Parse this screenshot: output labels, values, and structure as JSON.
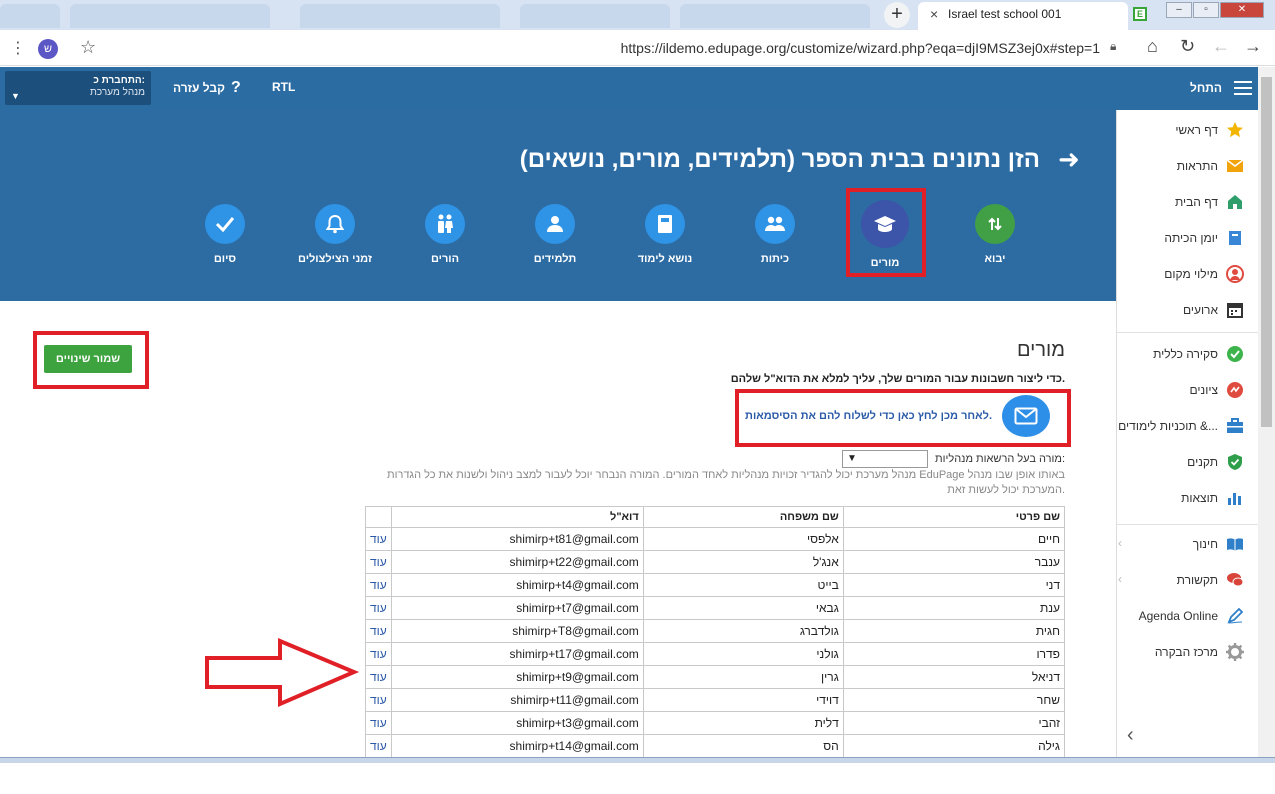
{
  "browser": {
    "tab_title": "Israel test school 001",
    "tab_close": "×",
    "new_tab": "+",
    "favicon_letter": "E",
    "url": "https://ildemo.edupage.org/customize/wizard.php?eqa=djI9MSZ3ej0x#step=1",
    "extension_letter": "ש",
    "window_controls": [
      "–",
      "▫",
      "✕"
    ]
  },
  "header": {
    "account_line1": "התחברת כ:",
    "account_line2": "מנהל מערכת",
    "help_label": "קבל עזרה",
    "help_icon": "?",
    "rtl_label": "RTL",
    "start_label": "התחל"
  },
  "banner": {
    "title": "הזן נתונים בבית הספר (תלמידים, מורים, נושאים)",
    "steps": [
      {
        "label": "יבוא",
        "icon": "import-arrows-icon"
      },
      {
        "label": "מורים",
        "icon": "graduation-cap-icon"
      },
      {
        "label": "כיתות",
        "icon": "group-icon"
      },
      {
        "label": "נושא לימוד",
        "icon": "book-icon"
      },
      {
        "label": "תלמידים",
        "icon": "person-icon"
      },
      {
        "label": "הורים",
        "icon": "parents-icon"
      },
      {
        "label": "זמני הצילצולים",
        "icon": "bell-icon"
      },
      {
        "label": "סיום",
        "icon": "check-icon"
      }
    ],
    "active_step": "מורים"
  },
  "sidebar": {
    "items": [
      {
        "label": "דף ראשי",
        "icon": "star-icon",
        "color": "#f2b600"
      },
      {
        "label": "התראות",
        "icon": "envelope-icon",
        "color": "#f0a30a"
      },
      {
        "label": "דף הבית",
        "icon": "house-icon",
        "color": "#2e9e6a"
      },
      {
        "label": "יומן הכיתה",
        "icon": "notebook-icon",
        "color": "#3a86d6"
      },
      {
        "label": "מילוי מקום",
        "icon": "substitute-icon",
        "color": "#e04b3f"
      },
      {
        "label": "ארועים",
        "icon": "calendar-icon",
        "color": "#333333"
      },
      {
        "label": "סקירה כללית",
        "icon": "check-circle-icon",
        "color": "#3cb44b"
      },
      {
        "label": "ציונים",
        "icon": "grades-icon",
        "color": "#e04b3f"
      },
      {
        "label": "תוכניות לימודים &...",
        "icon": "briefcase-icon",
        "color": "#2f80c8"
      },
      {
        "label": "תקנים",
        "icon": "shield-check-icon",
        "color": "#2e9e4a"
      },
      {
        "label": "תוצאות",
        "icon": "bar-chart-icon",
        "color": "#2f80c8"
      },
      {
        "label": "חינוך",
        "icon": "open-book-icon",
        "color": "#2f80c8"
      },
      {
        "label": "תקשורת",
        "icon": "chat-icon",
        "color": "#d8433a"
      },
      {
        "label": "Agenda Online",
        "icon": "pen-icon",
        "color": "#2f80c8"
      },
      {
        "label": "מרכז הבקרה",
        "icon": "gear-icon",
        "color": "#999999"
      }
    ],
    "collapse_icon": "‹"
  },
  "main": {
    "save_label": "שמור שינויים",
    "section_title": "מורים",
    "instruction": "כדי ליצור חשבונות עבור המורים שלך, עליך למלא את הדוא\"ל שלהם.",
    "send_passwords": "לאחר מכן לחץ כאן כדי לשלוח להם את הסיסמאות.",
    "admin_label": "מורה בעל הרשאות מנהליות:",
    "admin_select_value": "▼",
    "admin_note": "מנהל מערכת יכול להגדיר זכויות מנהליות לאחד המורים. המורה הנבחר יוכל לעבור למצב ניהול ולשנות את כל הגדרות EduPage באותו אופן שבו מנהל המערכת יכול לעשות זאת."
  },
  "table": {
    "headers": {
      "first": "שם פרטי",
      "last": "שם משפחה",
      "email": "דוא\"ל",
      "more": ""
    },
    "rows": [
      {
        "first": "חיים",
        "last": "אלפסי",
        "email": "shimirp+t81@gmail.com",
        "more": "עוד"
      },
      {
        "first": "ענבר",
        "last": "אנג'ל",
        "email": "shimirp+t22@gmail.com",
        "more": "עוד"
      },
      {
        "first": "דני",
        "last": "בייט",
        "email": "shimirp+t4@gmail.com",
        "more": "עוד"
      },
      {
        "first": "ענת",
        "last": "גבאי",
        "email": "shimirp+t7@gmail.com",
        "more": "עוד"
      },
      {
        "first": "חגית",
        "last": "גולדברג",
        "email": "shimirp+T8@gmail.com",
        "more": "עוד"
      },
      {
        "first": "פדרו",
        "last": "גולני",
        "email": "shimirp+t17@gmail.com",
        "more": "עוד"
      },
      {
        "first": "דניאל",
        "last": "גרין",
        "email": "shimirp+t9@gmail.com",
        "more": "עוד"
      },
      {
        "first": "שחר",
        "last": "דוידי",
        "email": "shimirp+t11@gmail.com",
        "more": "עוד"
      },
      {
        "first": "זהבי",
        "last": "דלית",
        "email": "shimirp+t3@gmail.com",
        "more": "עוד"
      },
      {
        "first": "גילה",
        "last": "הס",
        "email": "shimirp+t14@gmail.com",
        "more": "עוד"
      }
    ]
  },
  "colors": {
    "header_blue": "#2b6ca3",
    "step_blue": "#2f93e6",
    "active_step": "#3c55a8",
    "import_green": "#41a046",
    "save_green": "#3da33f",
    "highlight_red": "#e01f27",
    "link_blue": "#2b5aa8"
  }
}
